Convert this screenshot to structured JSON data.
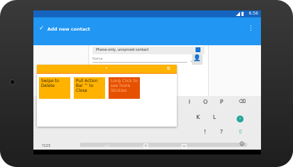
{
  "colors": {
    "app_bar": "#2196f3",
    "status_bar": "#1565c0",
    "popup_header": "#ffb300",
    "note_yellow": "#ffb300",
    "note_orange": "#e65100",
    "keyboard_accent": "#26a69a"
  },
  "status_bar": {
    "time": "6:56"
  },
  "app_bar": {
    "check_icon": "✓",
    "title": "Add new contact",
    "overflow_icon": "⋮"
  },
  "form": {
    "account_label": "Phone-only, unsynced contact",
    "name_placeholder": "Name",
    "expand_icon": "⌄",
    "photo_icon": "👤"
  },
  "popup": {
    "header_icon": "⧉",
    "notes": [
      {
        "text": "Swipe to Delete"
      },
      {
        "text": "Pull Action Bar ^ to Close"
      },
      {
        "text": "Long Click to see more Stickies"
      }
    ]
  },
  "keyboard": {
    "row1": [
      "I",
      "O",
      "P"
    ],
    "row2": [
      "K",
      "L"
    ],
    "row3": [
      "!",
      "?"
    ],
    "delete_icon": "⌫",
    "go_icon": "›",
    "shift_icon": "⇧",
    "numbers_key": "?123",
    "emoji_icon": "☺"
  },
  "nav": {
    "back_icon": "◁"
  }
}
